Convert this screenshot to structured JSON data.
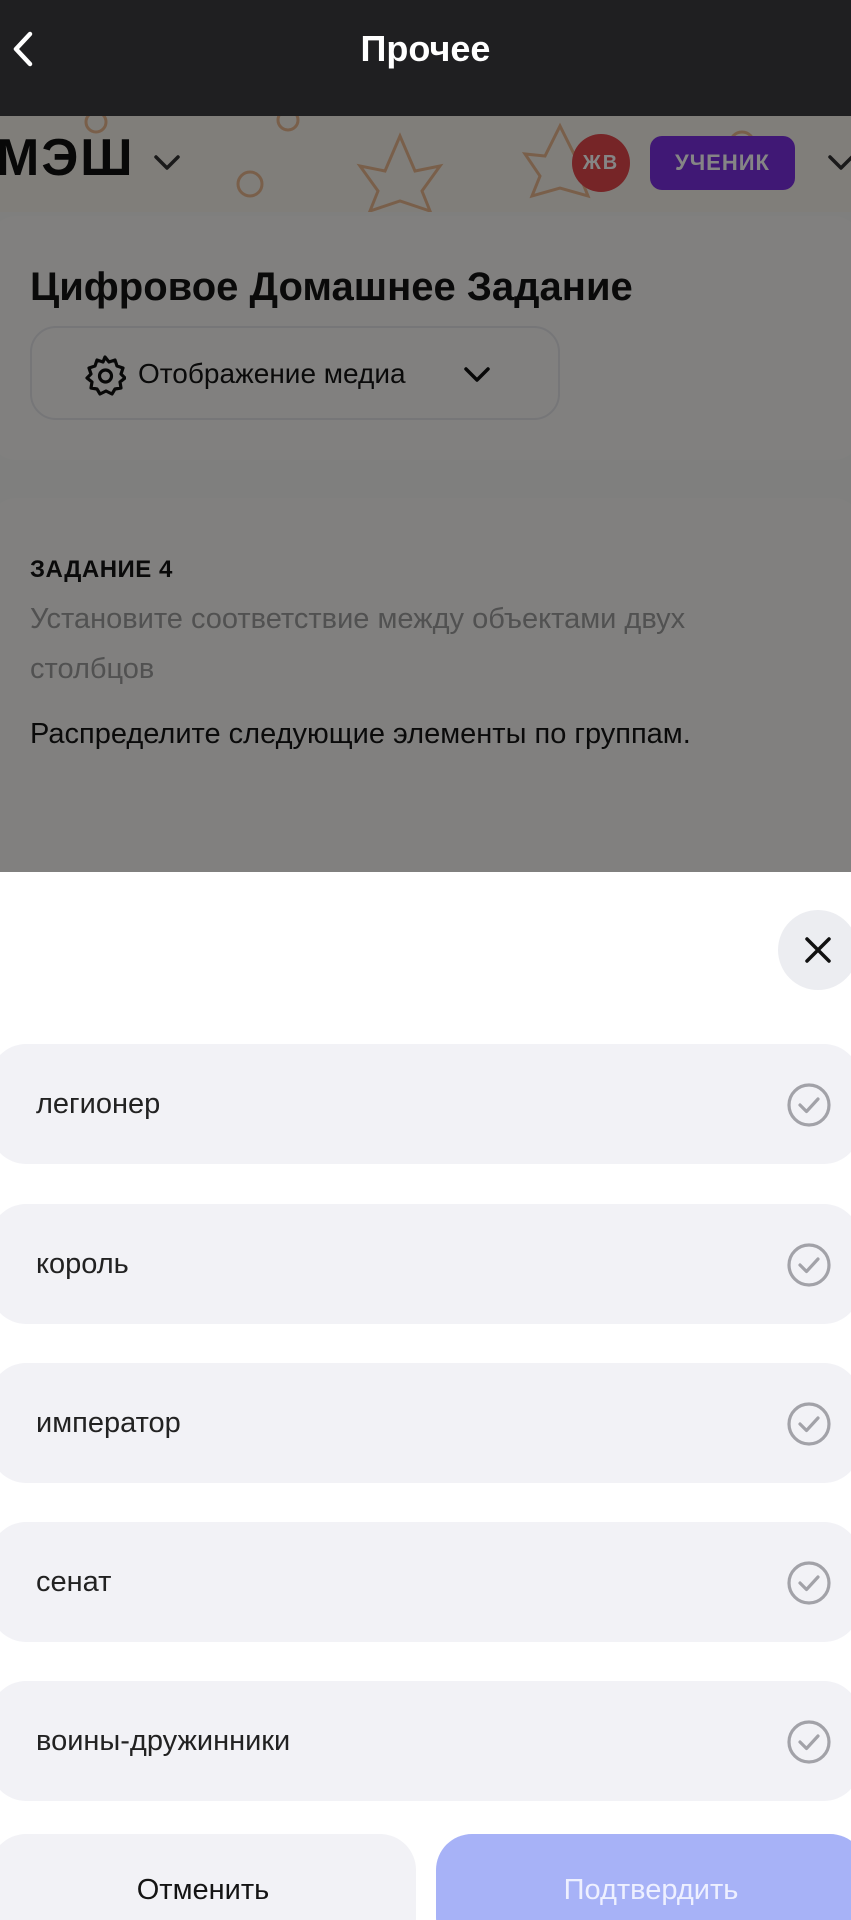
{
  "navbar": {
    "title": "Прочее",
    "back_icon": "chevron-left-icon"
  },
  "app_header": {
    "logo": "МЭШ",
    "avatar_initials": "ЖВ",
    "role_badge": "УЧЕНИК",
    "colors": {
      "avatar": "#e2484c",
      "role_badge": "#7b2fe0"
    }
  },
  "page": {
    "title": "Цифровое Домашнее Задание",
    "media_button_label": "Отображение медиа",
    "task": {
      "title": "ЗАДАНИЕ 4",
      "type": "Установите соответствие между объектами двух столбцов",
      "instruction": "Распределите следующие элементы по группам."
    }
  },
  "sheet": {
    "options": [
      {
        "label": "легионер"
      },
      {
        "label": "король"
      },
      {
        "label": "император"
      },
      {
        "label": "сенат"
      },
      {
        "label": "воины-дружинники"
      }
    ],
    "cancel_label": "Отменить",
    "confirm_label": "Подтвердить",
    "colors": {
      "confirm_bg": "#a7b2f7",
      "option_bg": "#f2f2f6"
    }
  }
}
